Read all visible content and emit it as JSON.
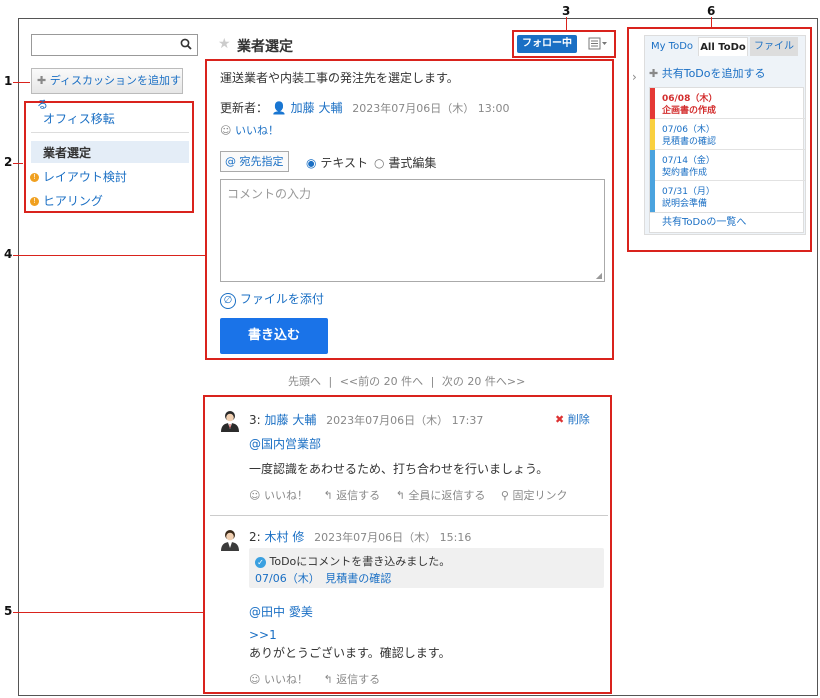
{
  "callouts": [
    "1",
    "2",
    "3",
    "4",
    "5",
    "6"
  ],
  "left": {
    "search_placeholder": "",
    "add_discussion": "ディスカッションを追加する",
    "categories": [
      {
        "label": "オフィス移転",
        "selected": false,
        "warn": false
      },
      {
        "label": "業者選定",
        "selected": true,
        "warn": false
      },
      {
        "label": "レイアウト検討",
        "selected": false,
        "warn": true
      },
      {
        "label": "ヒアリング",
        "selected": false,
        "warn": true
      }
    ]
  },
  "header": {
    "title": "業者選定",
    "follow_label": "フォロー中"
  },
  "discussion": {
    "body": "運送業者や内装工事の発注先を選定します。",
    "updater_label": "更新者：",
    "updater_name": "加藤 大輔",
    "updated_at": "2023年07月06日（木） 13:00",
    "like": "いいね！"
  },
  "composer": {
    "mention_button": "宛先指定",
    "mode_text": "テキスト",
    "mode_rich": "書式編集",
    "placeholder": "コメントの入力",
    "attach": "ファイルを添付",
    "submit": "書き込む"
  },
  "pager": {
    "first": "先頭へ",
    "sep": "|",
    "prev": "<<前の 20 件へ",
    "next": "次の 20 件へ>>"
  },
  "comments": [
    {
      "num": "3:",
      "author": "加藤 大輔",
      "date": "2023年07月06日（木） 17:37",
      "delete": "削除",
      "mention": "@国内営業部",
      "text": "一度認識をあわせるため、打ち合わせを行いましょう。",
      "actions": [
        "いいね！",
        "返信する",
        "全員に返信する",
        "固定リンク"
      ]
    },
    {
      "num": "2:",
      "author": "木村 修",
      "date": "2023年07月06日（木） 15:16",
      "todo_notice": "ToDoにコメントを書き込みました。",
      "todo_link": "07/06（木）　見積書の確認",
      "mention": "@田中 愛美",
      "reply_ref": ">>1",
      "text": "ありがとうございます。確認します。",
      "actions": [
        "いいね！",
        "返信する"
      ]
    }
  ],
  "right": {
    "tabs": [
      "My ToDo",
      "All ToDo",
      "ファイル"
    ],
    "add_todo": "共有ToDoを追加する",
    "todos": [
      {
        "date": "06/08（木）",
        "name": "企画書の作成",
        "color": "#e53935",
        "overdue": true
      },
      {
        "date": "07/06（木）",
        "name": "見積書の確認",
        "color": "#f9d03f",
        "overdue": false
      },
      {
        "date": "07/14（金）",
        "name": "契約書作成",
        "color": "#4aa3df",
        "overdue": false
      },
      {
        "date": "07/31（月）",
        "name": "説明会準備",
        "color": "#4aa3df",
        "overdue": false
      }
    ],
    "list_link": "共有ToDoの一覧へ"
  },
  "colors": {
    "accent": "#1a73e8",
    "callout": "#d9231d"
  }
}
